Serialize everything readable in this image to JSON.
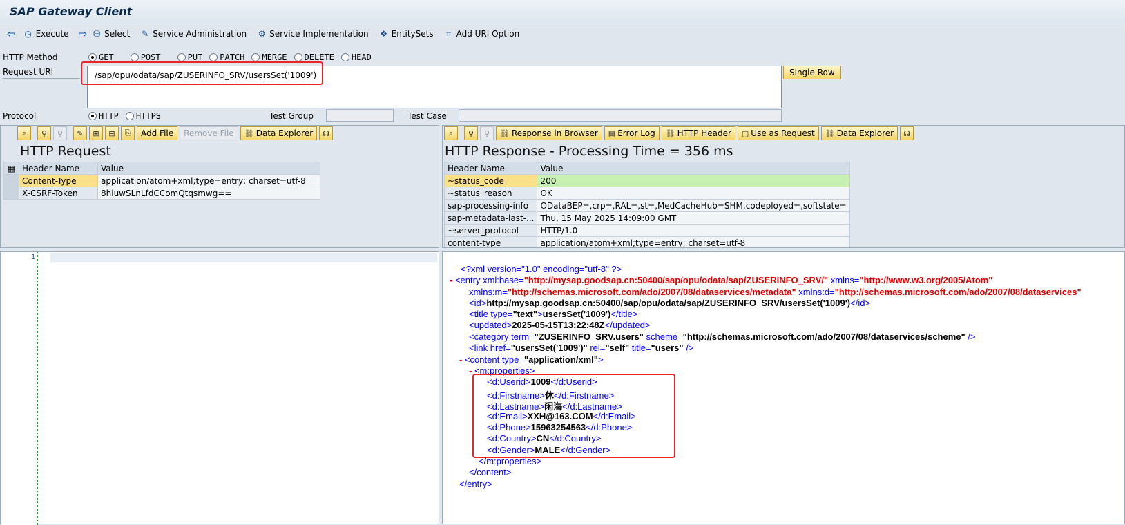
{
  "app": {
    "title": "SAP Gateway Client"
  },
  "toolbar": {
    "items": [
      {
        "label": "Execute"
      },
      {
        "label": "Select"
      },
      {
        "label": "Service Administration"
      },
      {
        "label": "Service Implementation"
      },
      {
        "label": "EntitySets"
      },
      {
        "label": "Add URI Option"
      }
    ]
  },
  "http_method": {
    "label": "HTTP Method",
    "options": [
      "GET",
      "POST",
      "PUT",
      "PATCH",
      "MERGE",
      "DELETE",
      "HEAD"
    ],
    "selected": "GET"
  },
  "request_uri": {
    "label": "Request URI",
    "value": "/sap/opu/odata/sap/ZUSERINFO_SRV/usersSet('1009')",
    "single_row": "Single Row"
  },
  "protocol": {
    "label": "Protocol",
    "options": [
      "HTTP",
      "HTTPS"
    ],
    "selected": "HTTP",
    "test_group": "Test Group",
    "test_case": "Test Case"
  },
  "request": {
    "title": "HTTP Request",
    "buttons": {
      "add_file": "Add File",
      "remove_file": "Remove File",
      "data_explorer": "Data Explorer"
    },
    "columns": [
      "Header Name",
      "Value"
    ],
    "rows": [
      {
        "name": "Content-Type",
        "value": "application/atom+xml;type=entry; charset=utf-8"
      },
      {
        "name": "X-CSRF-Token",
        "value": "8hiuwSLnLfdCComQtqsmwg=="
      }
    ]
  },
  "response": {
    "title": "HTTP Response - Processing Time = 356  ms",
    "buttons": {
      "browser": "Response in Browser",
      "error_log": "Error Log",
      "http_header": "HTTP Header",
      "use_as_request": "Use as Request",
      "data_explorer": "Data Explorer"
    },
    "columns": [
      "Header Name",
      "Value"
    ],
    "rows": [
      {
        "name": "~status_code",
        "value": "200"
      },
      {
        "name": "~status_reason",
        "value": "OK"
      },
      {
        "name": "sap-processing-info",
        "value": "ODataBEP=,crp=,RAL=,st=,MedCacheHub=SHM,codeployed=,softstate="
      },
      {
        "name": "sap-metadata-last-...",
        "value": "Thu, 15 May 2025 14:09:00 GMT"
      },
      {
        "name": "~server_protocol",
        "value": "HTTP/1.0"
      },
      {
        "name": "content-type",
        "value": "application/atom+xml;type=entry; charset=utf-8"
      }
    ]
  },
  "editor": {
    "line_number": "1"
  },
  "xml": {
    "decl": "<?xml version=\"1.0\" encoding=\"utf-8\" ?>",
    "minus": "-",
    "entry_open": "<entry xml:base=",
    "entry_base": "\"http://mysap.goodsap.cn:50400/sap/opu/odata/sap/ZUSERINFO_SRV/\"",
    "entry_xmlns": " xmlns=",
    "entry_xmlns_val": "\"http://www.w3.org/2005/Atom\"",
    "xmlns_m": "xmlns:m=",
    "xmlns_m_val": "\"http://schemas.microsoft.com/ado/2007/08/dataservices/metadata\"",
    "xmlns_d": " xmlns:d=",
    "xmlns_d_val": "\"http://schemas.microsoft.com/ado/2007/08/dataservices\"",
    "id_open": "<id>",
    "id_val": "http://mysap.goodsap.cn:50400/sap/opu/odata/sap/ZUSERINFO_SRV/usersSet('1009')",
    "id_close": "</id>",
    "title_open": "<title type=",
    "title_type": "\"text\"",
    "title_gt": ">",
    "title_val": "usersSet('1009')",
    "title_close": "</title>",
    "updated_open": "<updated>",
    "updated_val": "2025-05-15T13:22:48Z",
    "updated_close": "</updated>",
    "cat_open": "<category term=",
    "cat_term": "\"ZUSERINFO_SRV.users\"",
    "cat_scheme": " scheme=",
    "cat_scheme_val": "\"http://schemas.microsoft.com/ado/2007/08/dataservices/scheme\"",
    "cat_close": " />",
    "link_open": "<link href=",
    "link_href": "\"usersSet('1009')\"",
    "link_rel": " rel=",
    "link_rel_val": "\"self\"",
    "link_title": " title=",
    "link_title_val": "\"users\"",
    "link_close": " />",
    "content_open": "<content type=",
    "content_type": "\"application/xml\"",
    "content_gt": ">",
    "props_open": "<m:properties>",
    "props": [
      {
        "open": "<d:Userid>",
        "val": "1009",
        "close": "</d:Userid>"
      },
      {
        "open": "<d:Firstname>",
        "val": "休",
        "close": "</d:Firstname>"
      },
      {
        "open": "<d:Lastname>",
        "val": "闲海",
        "close": "</d:Lastname>"
      },
      {
        "open": "<d:Email>",
        "val": "XXH@163.COM",
        "close": "</d:Email>"
      },
      {
        "open": "<d:Phone>",
        "val": "15963254563",
        "close": "</d:Phone>"
      },
      {
        "open": "<d:Country>",
        "val": "CN",
        "close": "</d:Country>"
      },
      {
        "open": "<d:Gender>",
        "val": "MALE",
        "close": "</d:Gender>"
      }
    ],
    "props_close": "</m:properties>",
    "content_close": "</content>",
    "entry_close": "</entry>"
  }
}
